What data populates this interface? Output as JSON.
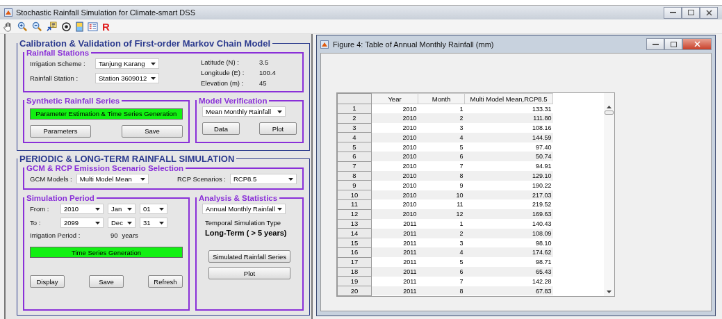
{
  "window": {
    "title": "Stochastic Rainfall Simulation for Climate-smart DSS"
  },
  "toolbar": {
    "r_label": "R"
  },
  "calibration": {
    "title": "Calibration & Validation of First-order Markov Chain Model",
    "stations": {
      "title": "Rainfall Stations",
      "fields": [
        {
          "label": "Irrigation Scheme :",
          "value": "Tanjung Karang"
        },
        {
          "label": "Rainfall Station :",
          "value": "Station 3609012"
        }
      ],
      "info": [
        {
          "label": "Latitude (N) :",
          "value": "3.5"
        },
        {
          "label": "Longitude (E) :",
          "value": "100.4"
        },
        {
          "label": "Elevation (m) :",
          "value": "45"
        }
      ]
    },
    "synthetic": {
      "title": "Synthetic Rainfall Series",
      "generate_button": "Parameter Estimation & Time Series Generation",
      "buttons": [
        "Parameters",
        "Save"
      ]
    },
    "verification": {
      "title": "Model Verification",
      "dropdown": "Mean Monthly Rainfall",
      "buttons": [
        "Data",
        "Plot"
      ]
    }
  },
  "periodic": {
    "title": "PERIODIC & LONG-TERM RAINFALL SIMULATION",
    "scenario": {
      "title": "GCM & RCP Emission Scenario Selection",
      "fields": [
        {
          "label": "GCM Models :",
          "value": "Multi Model Mean"
        },
        {
          "label": "RCP Scenarios :",
          "value": "RCP8.5"
        }
      ]
    },
    "period": {
      "title": "Simulation Period",
      "rows": [
        {
          "label": "From :",
          "values": [
            "2010",
            "Jan",
            "01"
          ]
        },
        {
          "label": "To :",
          "values": [
            "2099",
            "Dec",
            "31"
          ]
        }
      ],
      "irrigation_label": "Irrigation Period :",
      "irrigation_value": "90",
      "irrigation_unit": "years",
      "generate_button": "Time Series Generation",
      "buttons": [
        "Display",
        "Save",
        "Refresh"
      ]
    },
    "analysis": {
      "title": "Analysis & Statistics",
      "dropdown": "Annual Monthly Rainfall",
      "type_label": "Temporal Simulation Type",
      "type_value": "Long-Term ( > 5 years)",
      "buttons": [
        "Simulated Rainfall Series",
        "Plot"
      ]
    }
  },
  "figure": {
    "title": "Figure 4: Table of Annual Monthly Rainfall (mm)",
    "columns": [
      "Year",
      "Month",
      "Multi Model Mean,RCP8.5"
    ],
    "rows": [
      {
        "index": "1",
        "cells": [
          "2010",
          "1",
          "133.31"
        ]
      },
      {
        "index": "2",
        "cells": [
          "2010",
          "2",
          "111.80"
        ]
      },
      {
        "index": "3",
        "cells": [
          "2010",
          "3",
          "108.16"
        ]
      },
      {
        "index": "4",
        "cells": [
          "2010",
          "4",
          "144.59"
        ]
      },
      {
        "index": "5",
        "cells": [
          "2010",
          "5",
          "97.40"
        ]
      },
      {
        "index": "6",
        "cells": [
          "2010",
          "6",
          "50.74"
        ]
      },
      {
        "index": "7",
        "cells": [
          "2010",
          "7",
          "94.91"
        ]
      },
      {
        "index": "8",
        "cells": [
          "2010",
          "8",
          "129.10"
        ]
      },
      {
        "index": "9",
        "cells": [
          "2010",
          "9",
          "190.22"
        ]
      },
      {
        "index": "10",
        "cells": [
          "2010",
          "10",
          "217.03"
        ]
      },
      {
        "index": "11",
        "cells": [
          "2010",
          "11",
          "219.52"
        ]
      },
      {
        "index": "12",
        "cells": [
          "2010",
          "12",
          "169.63"
        ]
      },
      {
        "index": "13",
        "cells": [
          "2011",
          "1",
          "140.43"
        ]
      },
      {
        "index": "14",
        "cells": [
          "2011",
          "2",
          "108.09"
        ]
      },
      {
        "index": "15",
        "cells": [
          "2011",
          "3",
          "98.10"
        ]
      },
      {
        "index": "16",
        "cells": [
          "2011",
          "4",
          "174.62"
        ]
      },
      {
        "index": "17",
        "cells": [
          "2011",
          "5",
          "98.71"
        ]
      },
      {
        "index": "18",
        "cells": [
          "2011",
          "6",
          "65.43"
        ]
      },
      {
        "index": "19",
        "cells": [
          "2011",
          "7",
          "142.28"
        ]
      },
      {
        "index": "20",
        "cells": [
          "2011",
          "8",
          "67.83"
        ]
      }
    ]
  }
}
